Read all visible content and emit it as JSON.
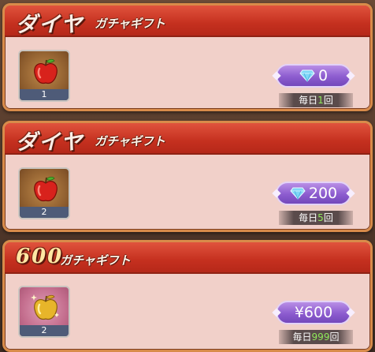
{
  "offers": [
    {
      "title_main": "ダイヤ",
      "title_sub": "ガチャギフト",
      "item_count": "1",
      "price": "0",
      "price_icon": "diamond-icon",
      "limit_prefix": "毎日",
      "limit_num": "1",
      "limit_suffix": "回"
    },
    {
      "title_main": "ダイヤ",
      "title_sub": "ガチャギフト",
      "item_count": "2",
      "price": "200",
      "price_icon": "diamond-icon",
      "limit_prefix": "毎日",
      "limit_num": "5",
      "limit_suffix": "回"
    },
    {
      "title_main": "600",
      "title_sub": "ガチャギフト",
      "item_count": "2",
      "price": "¥600",
      "limit_prefix": "毎日",
      "limit_num": "999",
      "limit_suffix": "回"
    }
  ],
  "colors": {
    "header_red": "#c5301f",
    "card_body": "#f1d0c9",
    "price_purple": "#8c5ccf",
    "limit_green": "#8fea5a"
  }
}
